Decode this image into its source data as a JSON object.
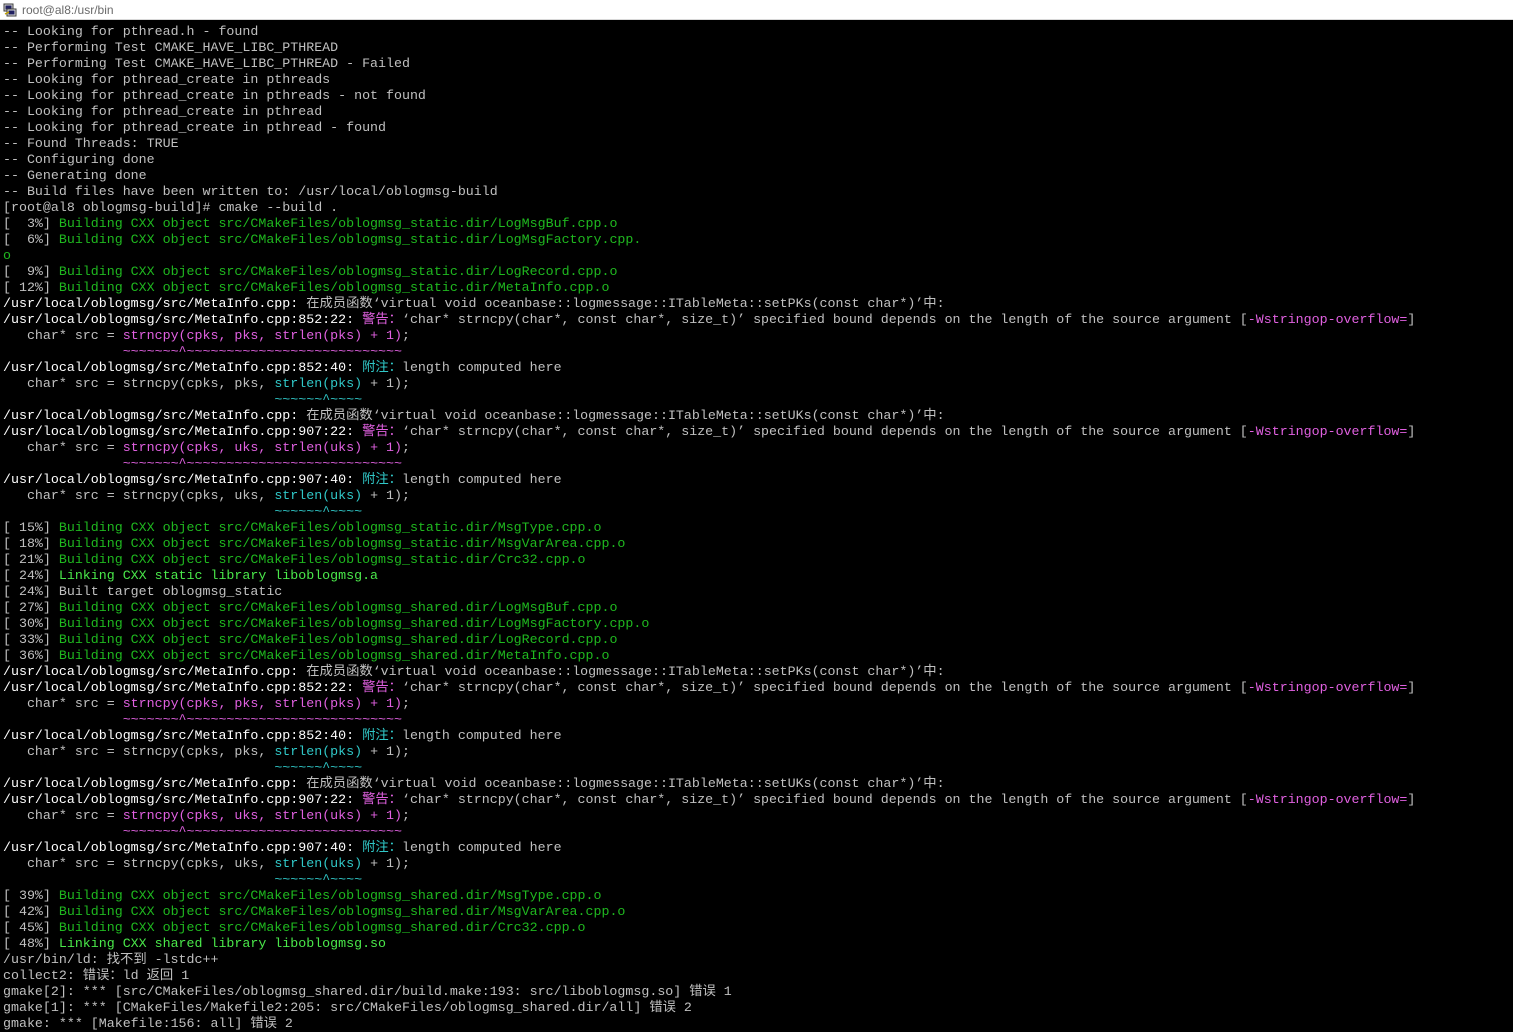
{
  "window": {
    "title": "root@al8:/usr/bin",
    "app_icon": "putty-terminal-icon",
    "background": "#000000"
  },
  "colors": {
    "text": "#c0c0c0",
    "green": "#1fb81f",
    "bright_green": "#4ae84a",
    "magenta": "#d030d0",
    "cyan": "#30c8c8"
  },
  "terminal": {
    "lines": [
      [
        {
          "t": "-- Looking for pthread.h - found",
          "c": "w"
        }
      ],
      [
        {
          "t": "-- Performing Test CMAKE_HAVE_LIBC_PTHREAD",
          "c": "w"
        }
      ],
      [
        {
          "t": "-- Performing Test CMAKE_HAVE_LIBC_PTHREAD - Failed",
          "c": "w"
        }
      ],
      [
        {
          "t": "-- Looking for pthread_create in pthreads",
          "c": "w"
        }
      ],
      [
        {
          "t": "-- Looking for pthread_create in pthreads - not found",
          "c": "w"
        }
      ],
      [
        {
          "t": "-- Looking for pthread_create in pthread",
          "c": "w"
        }
      ],
      [
        {
          "t": "-- Looking for pthread_create in pthread - found",
          "c": "w"
        }
      ],
      [
        {
          "t": "-- Found Threads: TRUE",
          "c": "w"
        }
      ],
      [
        {
          "t": "-- Configuring done",
          "c": "w"
        }
      ],
      [
        {
          "t": "-- Generating done",
          "c": "w"
        }
      ],
      [
        {
          "t": "-- Build files have been written to: /usr/local/oblogmsg-build",
          "c": "w"
        }
      ],
      [
        {
          "t": "[root@al8 oblogmsg-build]# cmake --build .",
          "c": "w"
        }
      ],
      [
        {
          "t": "[  3%] ",
          "c": "w"
        },
        {
          "t": "Building CXX object src/CMakeFiles/oblogmsg_static.dir/LogMsgBuf.cpp.o",
          "c": "g"
        }
      ],
      [
        {
          "t": "[  6%] ",
          "c": "w"
        },
        {
          "t": "Building CXX object src/CMakeFiles/oblogmsg_static.dir/LogMsgFactory.cpp.",
          "c": "g"
        }
      ],
      [
        {
          "t": "o",
          "c": "g"
        }
      ],
      [
        {
          "t": "[  9%] ",
          "c": "w"
        },
        {
          "t": "Building CXX object src/CMakeFiles/oblogmsg_static.dir/LogRecord.cpp.o",
          "c": "g"
        }
      ],
      [
        {
          "t": "[ 12%] ",
          "c": "w"
        },
        {
          "t": "Building CXX object src/CMakeFiles/oblogmsg_static.dir/MetaInfo.cpp.o",
          "c": "g"
        }
      ],
      [
        {
          "t": "/usr/local/oblogmsg/src/MetaInfo.cpp: ",
          "c": "bw"
        },
        {
          "t": "在成员函数‘virtual void oceanbase::logmessage::ITableMeta::setPKs(const char*)’中:",
          "c": "w"
        }
      ],
      [
        {
          "t": "/usr/local/oblogmsg/src/MetaInfo.cpp:852:22: ",
          "c": "bw"
        },
        {
          "t": "警告：",
          "c": "bm"
        },
        {
          "t": "‘char* strncpy(char*, const char*, size_t)’ specified bound depends on the length of the source argument [",
          "c": "w"
        },
        {
          "t": "-Wstringop-overflow=",
          "c": "bm"
        },
        {
          "t": "]",
          "c": "w"
        }
      ],
      [
        {
          "t": "   char* src = ",
          "c": "w"
        },
        {
          "t": "strncpy(cpks, pks, strlen(pks) + 1)",
          "c": "bm"
        },
        {
          "t": ";",
          "c": "w"
        }
      ],
      [
        {
          "t": "               ",
          "c": "w"
        },
        {
          "t": "~~~~~~~^~~~~~~~~~~~~~~~~~~~~~~~~~~~",
          "c": "bm"
        }
      ],
      [
        {
          "t": "/usr/local/oblogmsg/src/MetaInfo.cpp:852:40: ",
          "c": "bw"
        },
        {
          "t": "附注：",
          "c": "c"
        },
        {
          "t": "length computed here",
          "c": "w"
        }
      ],
      [
        {
          "t": "   char* src = strncpy(cpks, pks, ",
          "c": "w"
        },
        {
          "t": "strlen(pks)",
          "c": "c"
        },
        {
          "t": " + 1);",
          "c": "w"
        }
      ],
      [
        {
          "t": "                                  ",
          "c": "w"
        },
        {
          "t": "~~~~~~^~~~~",
          "c": "c"
        }
      ],
      [
        {
          "t": "/usr/local/oblogmsg/src/MetaInfo.cpp: ",
          "c": "bw"
        },
        {
          "t": "在成员函数‘virtual void oceanbase::logmessage::ITableMeta::setUKs(const char*)’中:",
          "c": "w"
        }
      ],
      [
        {
          "t": "/usr/local/oblogmsg/src/MetaInfo.cpp:907:22: ",
          "c": "bw"
        },
        {
          "t": "警告：",
          "c": "bm"
        },
        {
          "t": "‘char* strncpy(char*, const char*, size_t)’ specified bound depends on the length of the source argument [",
          "c": "w"
        },
        {
          "t": "-Wstringop-overflow=",
          "c": "bm"
        },
        {
          "t": "]",
          "c": "w"
        }
      ],
      [
        {
          "t": "   char* src = ",
          "c": "w"
        },
        {
          "t": "strncpy(cpks, uks, strlen(uks) + 1)",
          "c": "bm"
        },
        {
          "t": ";",
          "c": "w"
        }
      ],
      [
        {
          "t": "               ",
          "c": "w"
        },
        {
          "t": "~~~~~~~^~~~~~~~~~~~~~~~~~~~~~~~~~~~",
          "c": "bm"
        }
      ],
      [
        {
          "t": "/usr/local/oblogmsg/src/MetaInfo.cpp:907:40: ",
          "c": "bw"
        },
        {
          "t": "附注：",
          "c": "c"
        },
        {
          "t": "length computed here",
          "c": "w"
        }
      ],
      [
        {
          "t": "   char* src = strncpy(cpks, uks, ",
          "c": "w"
        },
        {
          "t": "strlen(uks)",
          "c": "c"
        },
        {
          "t": " + 1);",
          "c": "w"
        }
      ],
      [
        {
          "t": "                                  ",
          "c": "w"
        },
        {
          "t": "~~~~~~^~~~~",
          "c": "c"
        }
      ],
      [
        {
          "t": "[ 15%] ",
          "c": "w"
        },
        {
          "t": "Building CXX object src/CMakeFiles/oblogmsg_static.dir/MsgType.cpp.o",
          "c": "g"
        }
      ],
      [
        {
          "t": "[ 18%] ",
          "c": "w"
        },
        {
          "t": "Building CXX object src/CMakeFiles/oblogmsg_static.dir/MsgVarArea.cpp.o",
          "c": "g"
        }
      ],
      [
        {
          "t": "[ 21%] ",
          "c": "w"
        },
        {
          "t": "Building CXX object src/CMakeFiles/oblogmsg_static.dir/Crc32.cpp.o",
          "c": "g"
        }
      ],
      [
        {
          "t": "[ 24%] ",
          "c": "w"
        },
        {
          "t": "Linking CXX static library liboblogmsg.a",
          "c": "bg"
        }
      ],
      [
        {
          "t": "[ 24%] Built target oblogmsg_static",
          "c": "w"
        }
      ],
      [
        {
          "t": "[ 27%] ",
          "c": "w"
        },
        {
          "t": "Building CXX object src/CMakeFiles/oblogmsg_shared.dir/LogMsgBuf.cpp.o",
          "c": "g"
        }
      ],
      [
        {
          "t": "[ 30%] ",
          "c": "w"
        },
        {
          "t": "Building CXX object src/CMakeFiles/oblogmsg_shared.dir/LogMsgFactory.cpp.o",
          "c": "g"
        }
      ],
      [
        {
          "t": "[ 33%] ",
          "c": "w"
        },
        {
          "t": "Building CXX object src/CMakeFiles/oblogmsg_shared.dir/LogRecord.cpp.o",
          "c": "g"
        }
      ],
      [
        {
          "t": "[ 36%] ",
          "c": "w"
        },
        {
          "t": "Building CXX object src/CMakeFiles/oblogmsg_shared.dir/MetaInfo.cpp.o",
          "c": "g"
        }
      ],
      [
        {
          "t": "/usr/local/oblogmsg/src/MetaInfo.cpp: ",
          "c": "bw"
        },
        {
          "t": "在成员函数‘virtual void oceanbase::logmessage::ITableMeta::setPKs(const char*)’中:",
          "c": "w"
        }
      ],
      [
        {
          "t": "/usr/local/oblogmsg/src/MetaInfo.cpp:852:22: ",
          "c": "bw"
        },
        {
          "t": "警告：",
          "c": "bm"
        },
        {
          "t": "‘char* strncpy(char*, const char*, size_t)’ specified bound depends on the length of the source argument [",
          "c": "w"
        },
        {
          "t": "-Wstringop-overflow=",
          "c": "bm"
        },
        {
          "t": "]",
          "c": "w"
        }
      ],
      [
        {
          "t": "   char* src = ",
          "c": "w"
        },
        {
          "t": "strncpy(cpks, pks, strlen(pks) + 1)",
          "c": "bm"
        },
        {
          "t": ";",
          "c": "w"
        }
      ],
      [
        {
          "t": "               ",
          "c": "w"
        },
        {
          "t": "~~~~~~~^~~~~~~~~~~~~~~~~~~~~~~~~~~~",
          "c": "bm"
        }
      ],
      [
        {
          "t": "/usr/local/oblogmsg/src/MetaInfo.cpp:852:40: ",
          "c": "bw"
        },
        {
          "t": "附注：",
          "c": "c"
        },
        {
          "t": "length computed here",
          "c": "w"
        }
      ],
      [
        {
          "t": "   char* src = strncpy(cpks, pks, ",
          "c": "w"
        },
        {
          "t": "strlen(pks)",
          "c": "c"
        },
        {
          "t": " + 1);",
          "c": "w"
        }
      ],
      [
        {
          "t": "                                  ",
          "c": "w"
        },
        {
          "t": "~~~~~~^~~~~",
          "c": "c"
        }
      ],
      [
        {
          "t": "/usr/local/oblogmsg/src/MetaInfo.cpp: ",
          "c": "bw"
        },
        {
          "t": "在成员函数‘virtual void oceanbase::logmessage::ITableMeta::setUKs(const char*)’中:",
          "c": "w"
        }
      ],
      [
        {
          "t": "/usr/local/oblogmsg/src/MetaInfo.cpp:907:22: ",
          "c": "bw"
        },
        {
          "t": "警告：",
          "c": "bm"
        },
        {
          "t": "‘char* strncpy(char*, const char*, size_t)’ specified bound depends on the length of the source argument [",
          "c": "w"
        },
        {
          "t": "-Wstringop-overflow=",
          "c": "bm"
        },
        {
          "t": "]",
          "c": "w"
        }
      ],
      [
        {
          "t": "   char* src = ",
          "c": "w"
        },
        {
          "t": "strncpy(cpks, uks, strlen(uks) + 1)",
          "c": "bm"
        },
        {
          "t": ";",
          "c": "w"
        }
      ],
      [
        {
          "t": "               ",
          "c": "w"
        },
        {
          "t": "~~~~~~~^~~~~~~~~~~~~~~~~~~~~~~~~~~~",
          "c": "bm"
        }
      ],
      [
        {
          "t": "/usr/local/oblogmsg/src/MetaInfo.cpp:907:40: ",
          "c": "bw"
        },
        {
          "t": "附注：",
          "c": "c"
        },
        {
          "t": "length computed here",
          "c": "w"
        }
      ],
      [
        {
          "t": "   char* src = strncpy(cpks, uks, ",
          "c": "w"
        },
        {
          "t": "strlen(uks)",
          "c": "c"
        },
        {
          "t": " + 1);",
          "c": "w"
        }
      ],
      [
        {
          "t": "                                  ",
          "c": "w"
        },
        {
          "t": "~~~~~~^~~~~",
          "c": "c"
        }
      ],
      [
        {
          "t": "[ 39%] ",
          "c": "w"
        },
        {
          "t": "Building CXX object src/CMakeFiles/oblogmsg_shared.dir/MsgType.cpp.o",
          "c": "g"
        }
      ],
      [
        {
          "t": "[ 42%] ",
          "c": "w"
        },
        {
          "t": "Building CXX object src/CMakeFiles/oblogmsg_shared.dir/MsgVarArea.cpp.o",
          "c": "g"
        }
      ],
      [
        {
          "t": "[ 45%] ",
          "c": "w"
        },
        {
          "t": "Building CXX object src/CMakeFiles/oblogmsg_shared.dir/Crc32.cpp.o",
          "c": "g"
        }
      ],
      [
        {
          "t": "[ 48%] ",
          "c": "w"
        },
        {
          "t": "Linking CXX shared library liboblogmsg.so",
          "c": "bg"
        }
      ],
      [
        {
          "t": "/usr/bin/ld: 找不到 -lstdc++",
          "c": "w"
        }
      ],
      [
        {
          "t": "collect2: 错误：ld 返回 1",
          "c": "w"
        }
      ],
      [
        {
          "t": "gmake[2]: *** [src/CMakeFiles/oblogmsg_shared.dir/build.make:193: src/liboblogmsg.so] 错误 1",
          "c": "w"
        }
      ],
      [
        {
          "t": "gmake[1]: *** [CMakeFiles/Makefile2:205: src/CMakeFiles/oblogmsg_shared.dir/all] 错误 2",
          "c": "w"
        }
      ],
      [
        {
          "t": "gmake: *** [Makefile:156: all] 错误 2",
          "c": "w"
        }
      ]
    ]
  }
}
